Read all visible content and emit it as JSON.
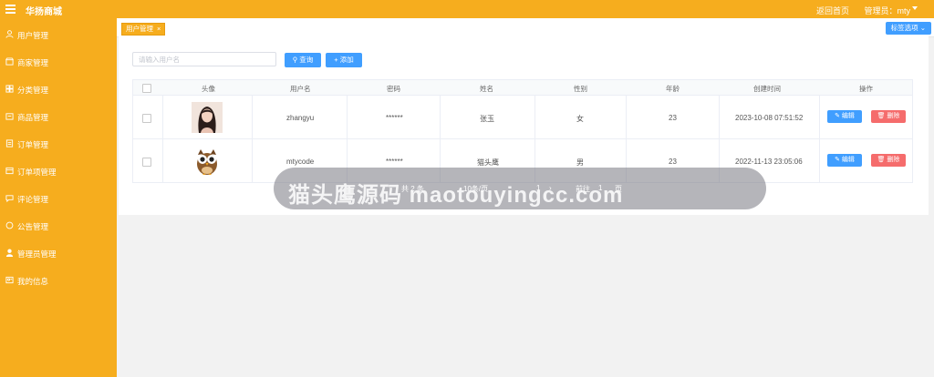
{
  "header": {
    "app_title": "华扬商城",
    "home_link": "返回首页",
    "admin_label": "管理员：mty"
  },
  "sidebar": {
    "items": [
      {
        "label": "用户管理",
        "icon": "user-icon"
      },
      {
        "label": "商家管理",
        "icon": "store-icon"
      },
      {
        "label": "分类管理",
        "icon": "category-icon"
      },
      {
        "label": "商品管理",
        "icon": "goods-icon"
      },
      {
        "label": "订单管理",
        "icon": "order-icon"
      },
      {
        "label": "订单项管理",
        "icon": "order-item-icon"
      },
      {
        "label": "评论管理",
        "icon": "comment-icon"
      },
      {
        "label": "公告管理",
        "icon": "notice-icon"
      },
      {
        "label": "管理员管理",
        "icon": "admin-icon"
      },
      {
        "label": "我的信息",
        "icon": "profile-icon"
      }
    ]
  },
  "tabs": {
    "active_label": "用户管理",
    "close_symbol": "×",
    "options_label": "标签选项"
  },
  "search": {
    "placeholder": "请输入用户名",
    "query_label": "查询",
    "add_label": "添加"
  },
  "table": {
    "headers": [
      "头像",
      "用户名",
      "密码",
      "姓名",
      "性别",
      "年龄",
      "创建时间",
      "操作"
    ],
    "rows": [
      {
        "username": "zhangyu",
        "password": "******",
        "name": "张玉",
        "gender": "女",
        "age": "23",
        "created": "2023-10-08 07:51:52"
      },
      {
        "username": "mtycode",
        "password": "******",
        "name": "猫头鹰",
        "gender": "男",
        "age": "23",
        "created": "2022-11-13 23:05:06"
      }
    ],
    "edit_label": "编辑",
    "delete_label": "删除"
  },
  "pagination": {
    "total": "共 2 条",
    "page_size": "10条/页",
    "current_page": "1",
    "goto_label": "前往",
    "goto_value": "1",
    "page_unit": "页"
  },
  "overlay": {
    "watermark_text": "猫头鹰源码 maotouyingcc.com"
  },
  "colors": {
    "brand_orange": "#f6ad1e",
    "primary_blue": "#409eff",
    "danger_red": "#f56c6c"
  }
}
